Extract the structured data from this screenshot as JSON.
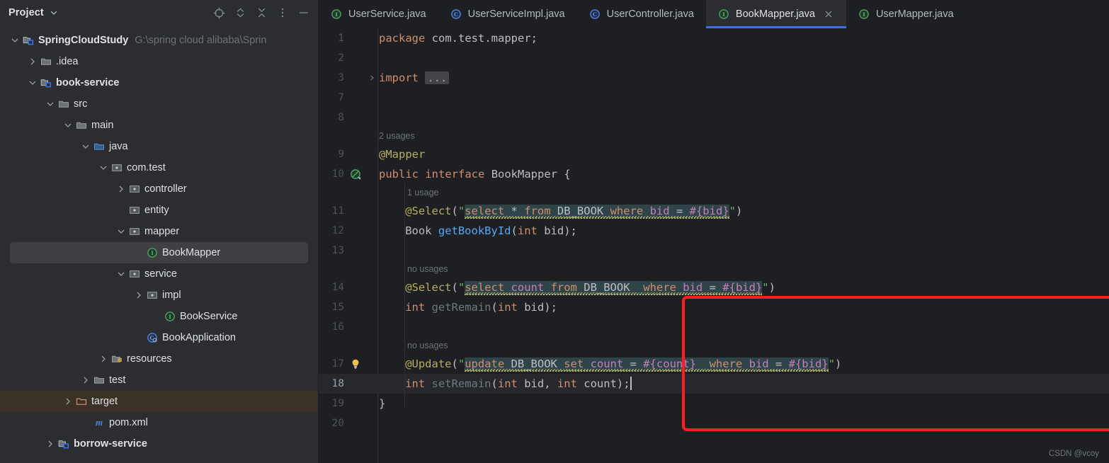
{
  "sidebar": {
    "title": "Project",
    "tools": [
      {
        "name": "locate-icon",
        "label": "Select Opened File"
      },
      {
        "name": "expand-collapse-icon",
        "label": "Expand / Collapse"
      },
      {
        "name": "collapse-all-icon",
        "label": "Collapse All"
      },
      {
        "name": "more-options-icon",
        "label": "Options"
      },
      {
        "name": "minimize-icon",
        "label": "Hide"
      }
    ],
    "tree": [
      {
        "label": "SpringCloudStudy",
        "path": "G:\\spring cloud alibaba\\Sprin",
        "icon": "module-root-icon",
        "arrow": "down",
        "indent": 0,
        "bold": true,
        "state": "normal"
      },
      {
        "label": ".idea",
        "path": "",
        "icon": "folder-icon",
        "arrow": "right",
        "indent": 1,
        "bold": false,
        "state": "normal"
      },
      {
        "label": "book-service",
        "path": "",
        "icon": "module-icon",
        "arrow": "down",
        "indent": 1,
        "bold": true,
        "state": "normal"
      },
      {
        "label": "src",
        "path": "",
        "icon": "folder-icon",
        "arrow": "down",
        "indent": 2,
        "bold": false,
        "state": "normal"
      },
      {
        "label": "main",
        "path": "",
        "icon": "folder-icon",
        "arrow": "down",
        "indent": 3,
        "bold": false,
        "state": "normal"
      },
      {
        "label": "java",
        "path": "",
        "icon": "source-folder-icon",
        "arrow": "down",
        "indent": 4,
        "bold": false,
        "state": "normal"
      },
      {
        "label": "com.test",
        "path": "",
        "icon": "package-icon",
        "arrow": "down",
        "indent": 5,
        "bold": false,
        "state": "normal"
      },
      {
        "label": "controller",
        "path": "",
        "icon": "package-icon",
        "arrow": "right",
        "indent": 6,
        "bold": false,
        "state": "normal"
      },
      {
        "label": "entity",
        "path": "",
        "icon": "package-icon",
        "arrow": "none",
        "indent": 6,
        "bold": false,
        "state": "normal"
      },
      {
        "label": "mapper",
        "path": "",
        "icon": "package-icon",
        "arrow": "down",
        "indent": 6,
        "bold": false,
        "state": "normal"
      },
      {
        "label": "BookMapper",
        "path": "",
        "icon": "interface-icon",
        "arrow": "none",
        "indent": 7,
        "bold": false,
        "state": "selected"
      },
      {
        "label": "service",
        "path": "",
        "icon": "package-icon",
        "arrow": "down",
        "indent": 6,
        "bold": false,
        "state": "normal"
      },
      {
        "label": "impl",
        "path": "",
        "icon": "package-icon",
        "arrow": "right",
        "indent": 7,
        "bold": false,
        "state": "normal"
      },
      {
        "label": "BookService",
        "path": "",
        "icon": "interface-icon",
        "arrow": "none",
        "indent": 8,
        "bold": false,
        "state": "normal"
      },
      {
        "label": "BookApplication",
        "path": "",
        "icon": "spring-class-icon",
        "arrow": "none",
        "indent": 7,
        "bold": false,
        "state": "normal"
      },
      {
        "label": "resources",
        "path": "",
        "icon": "resources-folder-icon",
        "arrow": "right",
        "indent": 5,
        "bold": false,
        "state": "normal"
      },
      {
        "label": "test",
        "path": "",
        "icon": "folder-icon",
        "arrow": "right",
        "indent": 4,
        "bold": false,
        "state": "normal"
      },
      {
        "label": "target",
        "path": "",
        "icon": "excluded-folder-icon",
        "arrow": "right",
        "indent": 3,
        "bold": false,
        "state": "excluded"
      },
      {
        "label": "pom.xml",
        "path": "",
        "icon": "maven-file-icon",
        "arrow": "none",
        "indent": 4,
        "bold": false,
        "state": "normal"
      },
      {
        "label": "borrow-service",
        "path": "",
        "icon": "module-icon",
        "arrow": "right",
        "indent": 2,
        "bold": true,
        "state": "normal"
      }
    ]
  },
  "tabs": [
    {
      "label": "UserService.java",
      "icon": "interface-icon",
      "active": false,
      "closable": false
    },
    {
      "label": "UserServiceImpl.java",
      "icon": "class-icon",
      "active": false,
      "closable": false
    },
    {
      "label": "UserController.java",
      "icon": "class-icon",
      "active": false,
      "closable": false
    },
    {
      "label": "BookMapper.java",
      "icon": "interface-icon",
      "active": true,
      "closable": true
    },
    {
      "label": "UserMapper.java",
      "icon": "interface-icon",
      "active": false,
      "closable": false
    }
  ],
  "editor": {
    "filename": "BookMapper.java",
    "close_label": "×",
    "lines": [
      {
        "num": "1",
        "text": "package com.test.mapper;"
      },
      {
        "num": "2",
        "text": ""
      },
      {
        "num": "3",
        "text": "import ...",
        "folded": true
      },
      {
        "num": "7",
        "text": ""
      },
      {
        "num": "8",
        "text": ""
      },
      {
        "num": "9",
        "text": "@Mapper",
        "hint": "2 usages"
      },
      {
        "num": "10",
        "text": "public interface BookMapper {",
        "gutter": "implemented-marker-icon"
      },
      {
        "num": "11",
        "text": "@Select(\"select * from DB_BOOK where bid = #{bid}\")",
        "hint": "1 usage"
      },
      {
        "num": "12",
        "text": "Book getBookById(int bid);"
      },
      {
        "num": "13",
        "text": ""
      },
      {
        "num": "14",
        "text": "@Select(\"select count from DB_BOOK  where bid = #{bid}\")",
        "hint": "no usages"
      },
      {
        "num": "15",
        "text": "int getRemain(int bid);"
      },
      {
        "num": "16",
        "text": ""
      },
      {
        "num": "17",
        "text": "@Update(\"update DB_BOOK set count = #{count}  where bid = #{bid}\")",
        "hint": "no usages",
        "gutter": "lightbulb-icon"
      },
      {
        "num": "18",
        "text": "int setRemain(int bid, int count);",
        "current": true
      },
      {
        "num": "19",
        "text": "}"
      },
      {
        "num": "20",
        "text": ""
      }
    ],
    "fold_placeholder": "..."
  },
  "annotation": {
    "highlight_color": "#fc1d1d",
    "label": "red-highlight-box"
  },
  "watermark": "CSDN @vcoy",
  "colors": {
    "accent": "#3574f0",
    "sidebar_bg": "#2b2d30",
    "editor_bg": "#1e1f22",
    "selected_row": "#3e4043",
    "excluded_row": "#3a3227",
    "sql_bg": "#2f4449"
  }
}
